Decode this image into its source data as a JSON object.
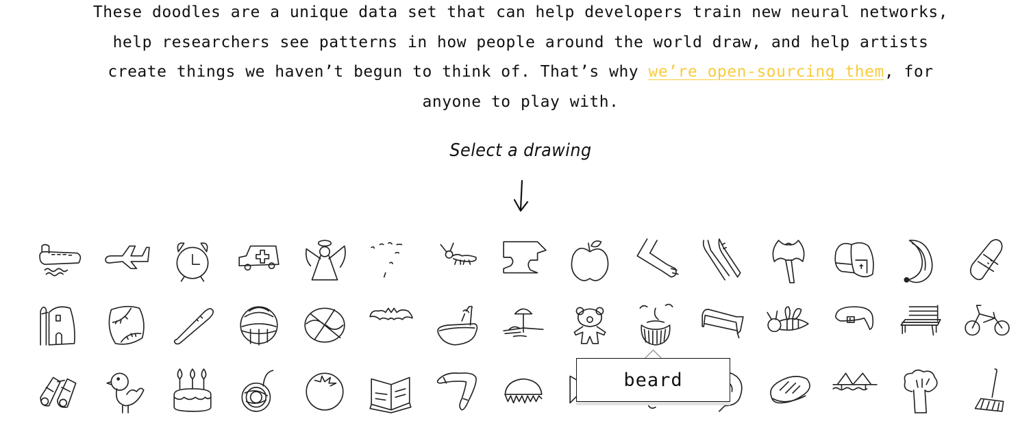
{
  "intro": {
    "lines": [
      "These doodles are a unique data set that can help developers train new neural networks,",
      "help researchers see patterns in how people around the world draw, and help artists"
    ],
    "line3_before": "create things we haven’t begun to think of. That’s why ",
    "link_text": "we’re open-sourcing them",
    "line3_after": ", for",
    "line4": "anyone to play with."
  },
  "select_prompt": "Select a drawing",
  "colors": {
    "link": "#f8cb3e",
    "text": "#111111",
    "tooltip_border": "#111111",
    "tooltip_shadow": "#e2e2e2"
  },
  "drawings": [
    [
      "aircraft-carrier",
      "airplane",
      "alarm-clock",
      "ambulance",
      "angel",
      "animal-migration",
      "ant",
      "anvil",
      "apple",
      "arm",
      "asparagus",
      "axe",
      "backpack",
      "banana",
      "bandage"
    ],
    [
      "barn",
      "baseball",
      "baseball-bat",
      "basket",
      "basketball",
      "bat",
      "bathtub",
      "beach",
      "bear",
      "beard",
      "bed",
      "bee",
      "belt",
      "bench",
      "bicycle"
    ],
    [
      "binoculars",
      "bird",
      "birthday-cake",
      "blackberry",
      "blueberry",
      "book",
      "boomerang",
      "bottlecap",
      "bowtie",
      "bracelet",
      "brain",
      "bread",
      "bridge",
      "broccoli",
      "broom"
    ]
  ],
  "tooltip": {
    "label": "beard",
    "target": "beard"
  }
}
